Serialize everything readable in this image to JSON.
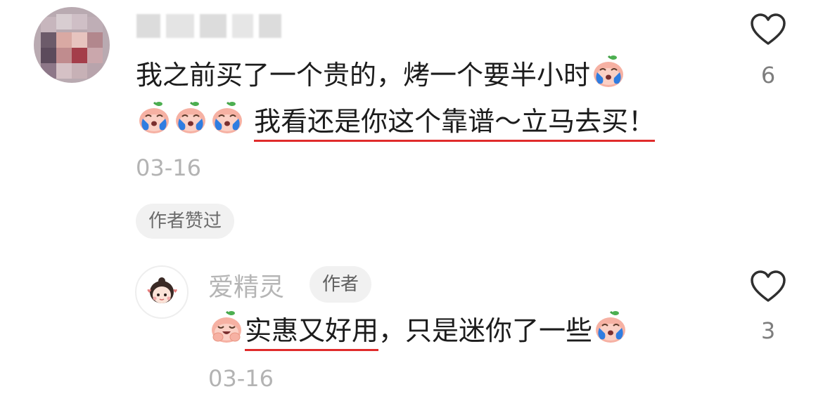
{
  "comment": {
    "line1": "我之前买了一个贵的，烤一个要半小时",
    "line2_highlight": "我看还是你这个靠谱～立马去买！",
    "date": "03-16",
    "author_liked_badge": "作者赞过",
    "like_count": "6",
    "emojis": [
      "crying-bun-emoji",
      "crying-bun-emoji",
      "crying-bun-emoji",
      "crying-bun-emoji"
    ]
  },
  "reply": {
    "username": "爱精灵",
    "author_tag": "作者",
    "text_highlight": "实惠又好用",
    "text_rest": "，只是迷你了一些",
    "date": "03-16",
    "like_count": "3",
    "emojis": [
      "laughing-bun-emoji",
      "crying-bun-emoji"
    ]
  },
  "colors": {
    "underline": "#e02b2b",
    "emoji_face": "#f6b1a3",
    "emoji_leaf": "#43a047",
    "tear": "#2f7de1"
  }
}
